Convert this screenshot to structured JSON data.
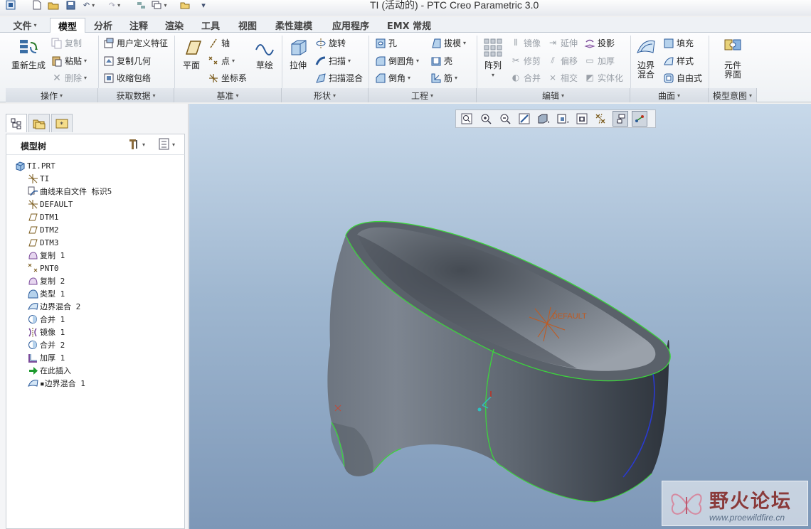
{
  "window": {
    "title": "TI (活动的) - PTC Creo Parametric 3.0"
  },
  "tabs": [
    {
      "label": "文件",
      "has_arrow": true
    },
    {
      "label": "模型",
      "active": true
    },
    {
      "label": "分析"
    },
    {
      "label": "注释"
    },
    {
      "label": "渲染"
    },
    {
      "label": "工具"
    },
    {
      "label": "视图"
    },
    {
      "label": "柔性建模"
    },
    {
      "label": "应用程序"
    },
    {
      "label": "EMX 常规"
    }
  ],
  "ribbon": {
    "groups": [
      {
        "label": "操作"
      },
      {
        "label": "获取数据"
      },
      {
        "label": "基准"
      },
      {
        "label": "形状"
      },
      {
        "label": "工程"
      },
      {
        "label": "编辑"
      },
      {
        "label": "曲面"
      },
      {
        "label": "模型意图"
      }
    ],
    "operations": {
      "regenerate": "重新生成",
      "copy": "复制",
      "paste": "粘贴",
      "delete": "删除"
    },
    "get_data": {
      "udf": "用户定义特征",
      "copy_geom": "复制几何",
      "shrinkwrap": "收缩包络"
    },
    "datum": {
      "plane": "平面",
      "axis": "轴",
      "point": "点",
      "csys": "坐标系",
      "sketch": "草绘"
    },
    "shapes": {
      "extrude": "拉伸",
      "revolve": "旋转",
      "sweep": "扫描",
      "swept_blend": "扫描混合"
    },
    "engineering": {
      "hole": "孔",
      "round": "倒圆角",
      "chamfer": "倒角",
      "draft": "拔模",
      "shell": "壳",
      "rib": "筋"
    },
    "editing": {
      "pattern": "阵列",
      "mirror": "镜像",
      "trim": "修剪",
      "merge": "合并",
      "extend": "延伸",
      "offset": "偏移",
      "intersect": "相交",
      "project": "投影",
      "thicken": "加厚",
      "solidify": "实体化"
    },
    "surfaces": {
      "boundary_blend": "边界\n混合",
      "fill": "填充",
      "style": "样式",
      "freestyle": "自由式"
    },
    "model_intent": {
      "component_interface": "元件\n界面"
    }
  },
  "panel": {
    "title": "模型树",
    "tree": [
      {
        "label": "TI.PRT",
        "icon": "part-icon"
      },
      {
        "label": "TI",
        "icon": "csys-icon"
      },
      {
        "label": "曲线来自文件 标识5",
        "icon": "curve-icon"
      },
      {
        "label": "DEFAULT",
        "icon": "csys-icon"
      },
      {
        "label": "DTM1",
        "icon": "datum-plane-icon"
      },
      {
        "label": "DTM2",
        "icon": "datum-plane-icon"
      },
      {
        "label": "DTM3",
        "icon": "datum-plane-icon"
      },
      {
        "label": "复制 1",
        "icon": "copy-surface-icon"
      },
      {
        "label": "PNT0",
        "icon": "datum-point-icon"
      },
      {
        "label": "复制 2",
        "icon": "copy-surface-icon"
      },
      {
        "label": "类型 1",
        "icon": "style-icon"
      },
      {
        "label": "边界混合 2",
        "icon": "boundary-blend-icon"
      },
      {
        "label": "合并 1",
        "icon": "merge-icon"
      },
      {
        "label": "镜像 1",
        "icon": "mirror-icon"
      },
      {
        "label": "合并 2",
        "icon": "merge-icon"
      },
      {
        "label": "加厚 1",
        "icon": "thicken-icon"
      },
      {
        "label": "在此插入",
        "icon": "insert-here-arrow-icon"
      },
      {
        "label": "▪边界混合 1",
        "icon": "boundary-blend-icon"
      }
    ]
  },
  "viewport": {
    "csys_label": "DEFAULT",
    "colors": {
      "model": "#5f6772",
      "edge": "#3cd43c",
      "background_top": "#c8d9ea",
      "background_bottom": "#7d97b7"
    }
  },
  "watermark": {
    "text": "野火论坛",
    "url": "www.proewildfire.cn"
  }
}
